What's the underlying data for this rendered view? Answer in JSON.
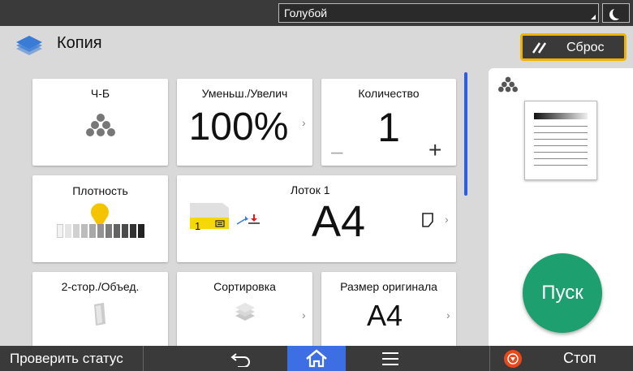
{
  "topbar": {
    "user_name": "Голубой"
  },
  "header": {
    "title": "Копия",
    "reset_label": "Сброс"
  },
  "tiles": {
    "color_mode": {
      "title": "Ч-Б"
    },
    "zoom": {
      "title": "Уменьш./Увелич",
      "value": "100%"
    },
    "quantity": {
      "title": "Количество",
      "value": "1",
      "minus": "–",
      "plus": "+"
    },
    "density": {
      "title": "Плотность",
      "level": 0.58
    },
    "tray": {
      "title": "Лоток 1",
      "paper_size": "A4",
      "tray_number": "1"
    },
    "duplex": {
      "title": "2-стор./Объед."
    },
    "sort": {
      "title": "Сортировка"
    },
    "original_size": {
      "title": "Размер оригинала",
      "value": "A4"
    }
  },
  "panel": {
    "start_label": "Пуск"
  },
  "bottombar": {
    "check_status_label": "Проверить статус",
    "stop_label": "Стоп"
  },
  "colors": {
    "accent_blue": "#3e6ee3",
    "start_green": "#1e9f6f",
    "reset_border": "#f0b400",
    "stop_red": "#e8481a",
    "density_marker": "#f5c400"
  }
}
